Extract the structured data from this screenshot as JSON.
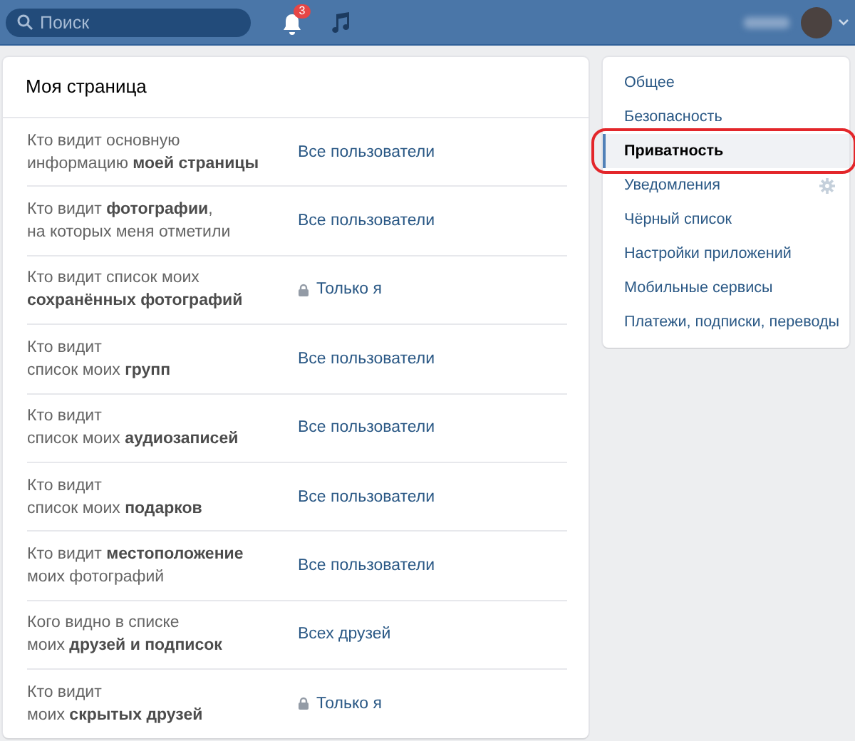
{
  "header": {
    "search": {
      "placeholder": "Поиск"
    },
    "notifications": {
      "badge": "3"
    }
  },
  "privacy_card": {
    "title": "Моя страница",
    "rows": [
      {
        "label": "Кто видит основную\nинформацию **моей страницы**",
        "value": "Все пользователи",
        "locked": false
      },
      {
        "label": "Кто видит **фотографии**,\nна которых меня отметили",
        "value": "Все пользователи",
        "locked": false
      },
      {
        "label": "Кто видит список моих\n**сохранённых фотографий**",
        "value": "Только я",
        "locked": true
      },
      {
        "label": "Кто видит\nсписок моих **групп**",
        "value": "Все пользователи",
        "locked": false
      },
      {
        "label": "Кто видит\nсписок моих **аудиозаписей**",
        "value": "Все пользователи",
        "locked": false
      },
      {
        "label": "Кто видит\nсписок моих **подарков**",
        "value": "Все пользователи",
        "locked": false
      },
      {
        "label": "Кто видит **местоположение**\nмоих фотографий",
        "value": "Все пользователи",
        "locked": false
      },
      {
        "label": "Кого видно в списке\nмоих **друзей и подписок**",
        "value": "Всех друзей",
        "locked": false
      },
      {
        "label": "Кто видит\nмоих **скрытых друзей**",
        "value": "Только я",
        "locked": true
      }
    ]
  },
  "settings_menu": {
    "items": [
      {
        "label": "Общее",
        "selected": false,
        "highlighted": false,
        "gear": false
      },
      {
        "label": "Безопасность",
        "selected": false,
        "highlighted": false,
        "gear": false
      },
      {
        "label": "Приватность",
        "selected": true,
        "highlighted": true,
        "gear": false
      },
      {
        "label": "Уведомления",
        "selected": false,
        "highlighted": false,
        "gear": true
      },
      {
        "label": "Чёрный список",
        "selected": false,
        "highlighted": false,
        "gear": false
      },
      {
        "label": "Настройки приложений",
        "selected": false,
        "highlighted": false,
        "gear": false
      },
      {
        "label": "Мобильные сервисы",
        "selected": false,
        "highlighted": false,
        "gear": false
      },
      {
        "label": "Платежи, подписки, переводы",
        "selected": false,
        "highlighted": false,
        "gear": false
      }
    ]
  }
}
